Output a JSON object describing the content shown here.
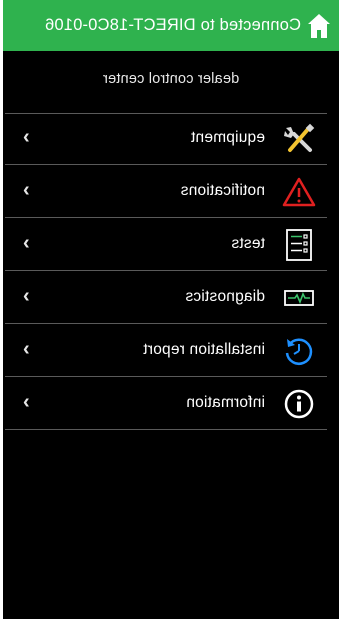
{
  "status_bar": {
    "connection_text": "Connected to DIRECT-18C0-0106",
    "home_icon": "home-icon",
    "background_color": "#2fb24e"
  },
  "page": {
    "title": "dealer control center"
  },
  "menu": {
    "chevron": "›",
    "items": [
      {
        "label": "equipment",
        "icon": "tools-icon",
        "accent": "#f4c430"
      },
      {
        "label": "notifications",
        "icon": "warning-icon",
        "accent": "#e02020"
      },
      {
        "label": "tests",
        "icon": "checklist-icon",
        "accent": "#ffffff"
      },
      {
        "label": "diagnostics",
        "icon": "pulse-monitor-icon",
        "accent": "#3cc36b"
      },
      {
        "label": "installation report",
        "icon": "clock-refresh-icon",
        "accent": "#1e90ff"
      },
      {
        "label": "information",
        "icon": "info-icon",
        "accent": "#ffffff"
      }
    ]
  }
}
